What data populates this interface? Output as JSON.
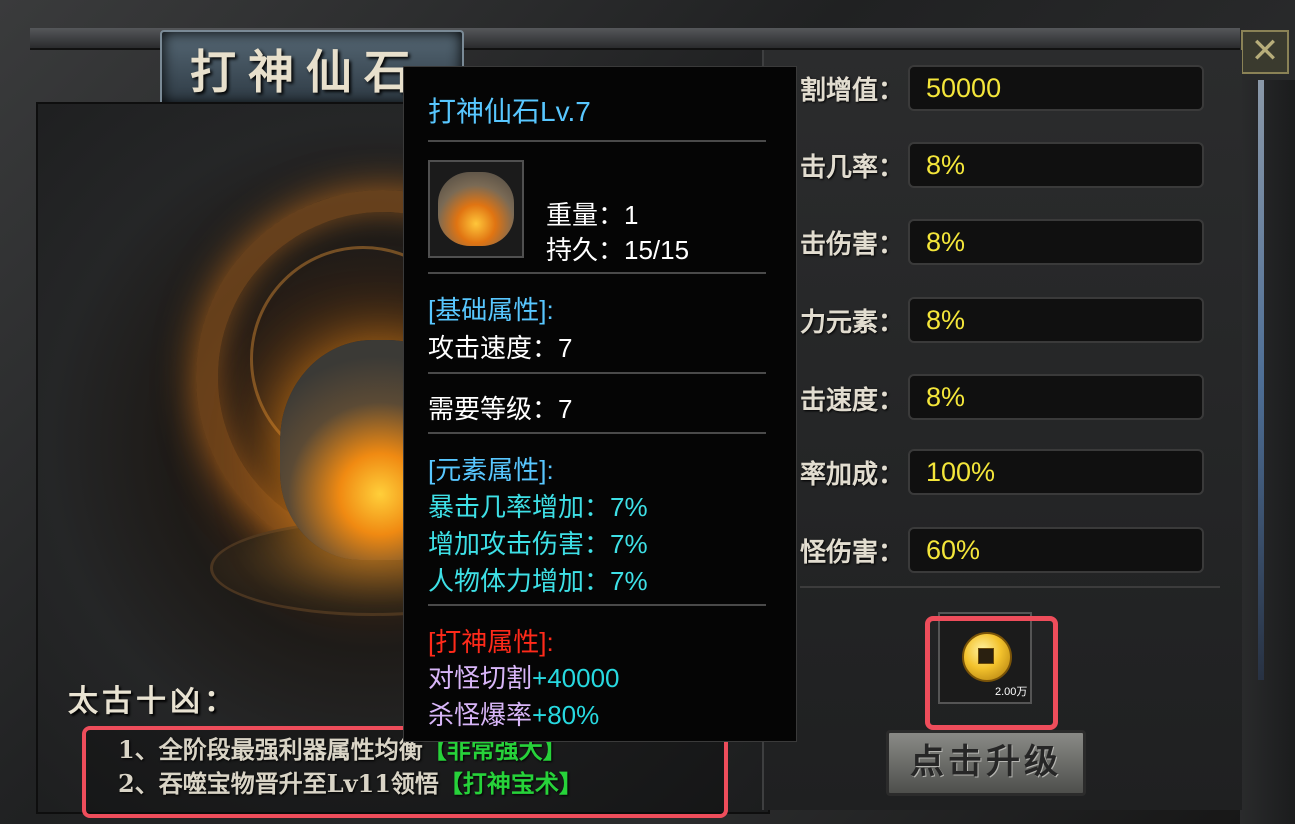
{
  "window": {
    "title": "打神仙石",
    "close_symbol": "✕"
  },
  "colors": {
    "stat_value": "#f4e63a",
    "highlight_red": "#ee4d5b",
    "tooltip_blue": "#58c7ff",
    "tooltip_cyan": "#3ee0e6",
    "tooltip_red": "#ff2a1a",
    "tooltip_lavender": "#d8b6f8",
    "green_highlight": "#27d23a"
  },
  "stats": [
    {
      "label": "割增值：",
      "value": "50000"
    },
    {
      "label": "击几率：",
      "value": "8%"
    },
    {
      "label": "击伤害：",
      "value": "8%"
    },
    {
      "label": "力元素：",
      "value": "8%"
    },
    {
      "label": "击速度：",
      "value": "8%"
    },
    {
      "label": "率加成：",
      "value": "100%"
    },
    {
      "label": "怪伤害：",
      "value": "60%"
    }
  ],
  "cost": {
    "icon": "gold-coin-icon",
    "amount": "2.00万"
  },
  "upgrade_button": "点击升级",
  "left": {
    "section_title": "太古十凶：",
    "lines": [
      {
        "text": "1、全阶段最强利器属性均衡",
        "highlight": "【非常强大】"
      },
      {
        "text": "2、吞噬宝物晋升至Lv11领悟",
        "highlight": "【打神宝术】"
      }
    ]
  },
  "tooltip": {
    "title": "打神仙石Lv.7",
    "item_icon": "stone-beast-icon",
    "weight": "重量：1",
    "durability": "持久：15/15",
    "base_header": "[基础属性]:",
    "attack_speed": "攻击速度：7",
    "required_level": "需要等级：7",
    "element_header": "[元素属性]:",
    "element_lines": [
      "暴击几率增加：7%",
      "增加攻击伤害：7%",
      "人物体力增加：7%"
    ],
    "special_header": "[打神属性]:",
    "special_lines": [
      {
        "label": "对怪切割",
        "value": "+40000"
      },
      {
        "label": "杀怪爆率",
        "value": "+80%"
      }
    ]
  }
}
